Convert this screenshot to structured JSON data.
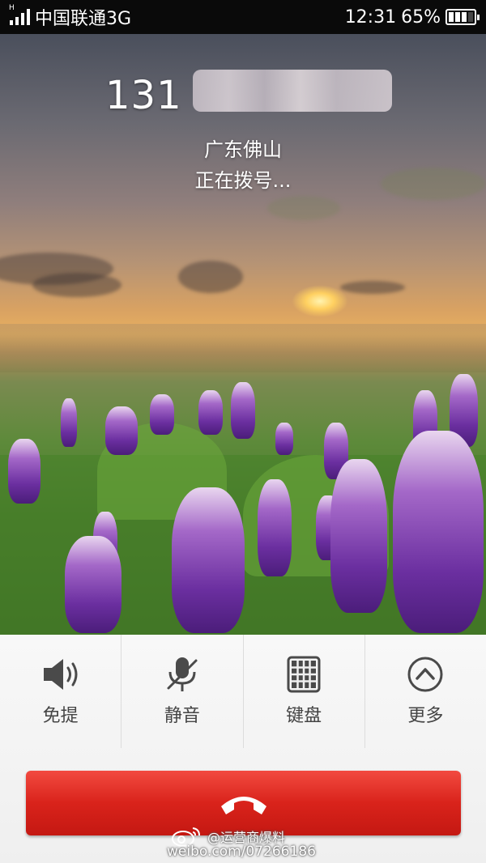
{
  "status_bar": {
    "signal_label": "H",
    "carrier": "中国联通3G",
    "time": "12:31",
    "battery_percent": "65%",
    "battery_level": 0.65
  },
  "call": {
    "number_prefix": "131",
    "location": "广东佛山",
    "status": "正在拨号..."
  },
  "controls": [
    {
      "label": "免提",
      "icon": "speaker-icon"
    },
    {
      "label": "静音",
      "icon": "mute-mic-icon"
    },
    {
      "label": "键盘",
      "icon": "keypad-icon"
    },
    {
      "label": "更多",
      "icon": "chevron-up-circle-icon"
    }
  ],
  "end_call": {
    "icon": "hang-up-phone-icon",
    "color": "#d9231b"
  },
  "watermark": {
    "handle": "@运营商爆料",
    "url": "weibo.com/07266186"
  }
}
